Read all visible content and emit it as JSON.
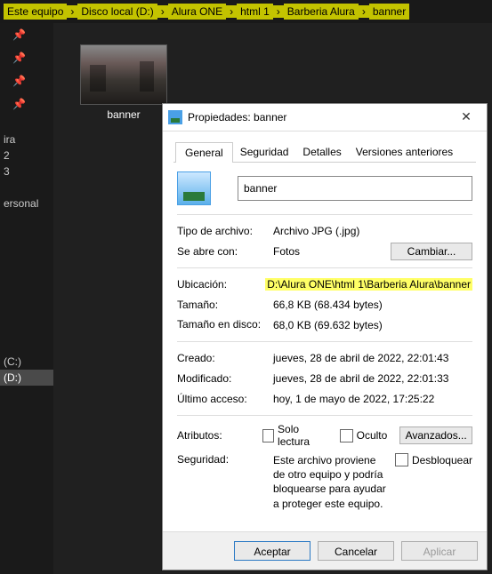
{
  "breadcrumb": {
    "items": [
      "Este equipo",
      "Disco local (D:)",
      "Alura ONE",
      "html 1",
      "Barberia Alura",
      "banner"
    ]
  },
  "sidebar": {
    "labels": [
      "ira",
      "2",
      "3"
    ],
    "personal": "ersonal",
    "drives": [
      {
        "label": "(C:)",
        "selected": false
      },
      {
        "label": "(D:)",
        "selected": true
      }
    ]
  },
  "content": {
    "thumb_name": "banner"
  },
  "dialog": {
    "title": "Propiedades: banner",
    "tabs": {
      "general": "General",
      "seguridad": "Seguridad",
      "detalles": "Detalles",
      "versiones": "Versiones anteriores"
    },
    "filename": "banner",
    "fields": {
      "tipo_label": "Tipo de archivo:",
      "tipo_value": "Archivo JPG (.jpg)",
      "abre_label": "Se abre con:",
      "abre_value": "Fotos",
      "cambiar": "Cambiar...",
      "ubic_label": "Ubicación:",
      "ubic_value": "D:\\Alura ONE\\html 1\\Barberia Alura\\banner",
      "tam_label": "Tamaño:",
      "tam_value": "66,8 KB (68.434 bytes)",
      "tamd_label": "Tamaño en disco:",
      "tamd_value": "68,0 KB (69.632 bytes)",
      "creado_label": "Creado:",
      "creado_value": "jueves, 28 de abril de 2022, 22:01:43",
      "modif_label": "Modificado:",
      "modif_value": "jueves, 28 de abril de 2022, 22:01:33",
      "acceso_label": "Último acceso:",
      "acceso_value": "hoy, 1 de mayo de 2022, 17:25:22",
      "attr_label": "Atributos:",
      "solo_lectura": "Solo lectura",
      "oculto": "Oculto",
      "avanzados": "Avanzados...",
      "seg_label": "Seguridad:",
      "seg_text": "Este archivo proviene de otro equipo y podría bloquearse para ayudar a proteger este equipo.",
      "desbloquear": "Desbloquear"
    },
    "buttons": {
      "aceptar": "Aceptar",
      "cancelar": "Cancelar",
      "aplicar": "Aplicar"
    }
  }
}
